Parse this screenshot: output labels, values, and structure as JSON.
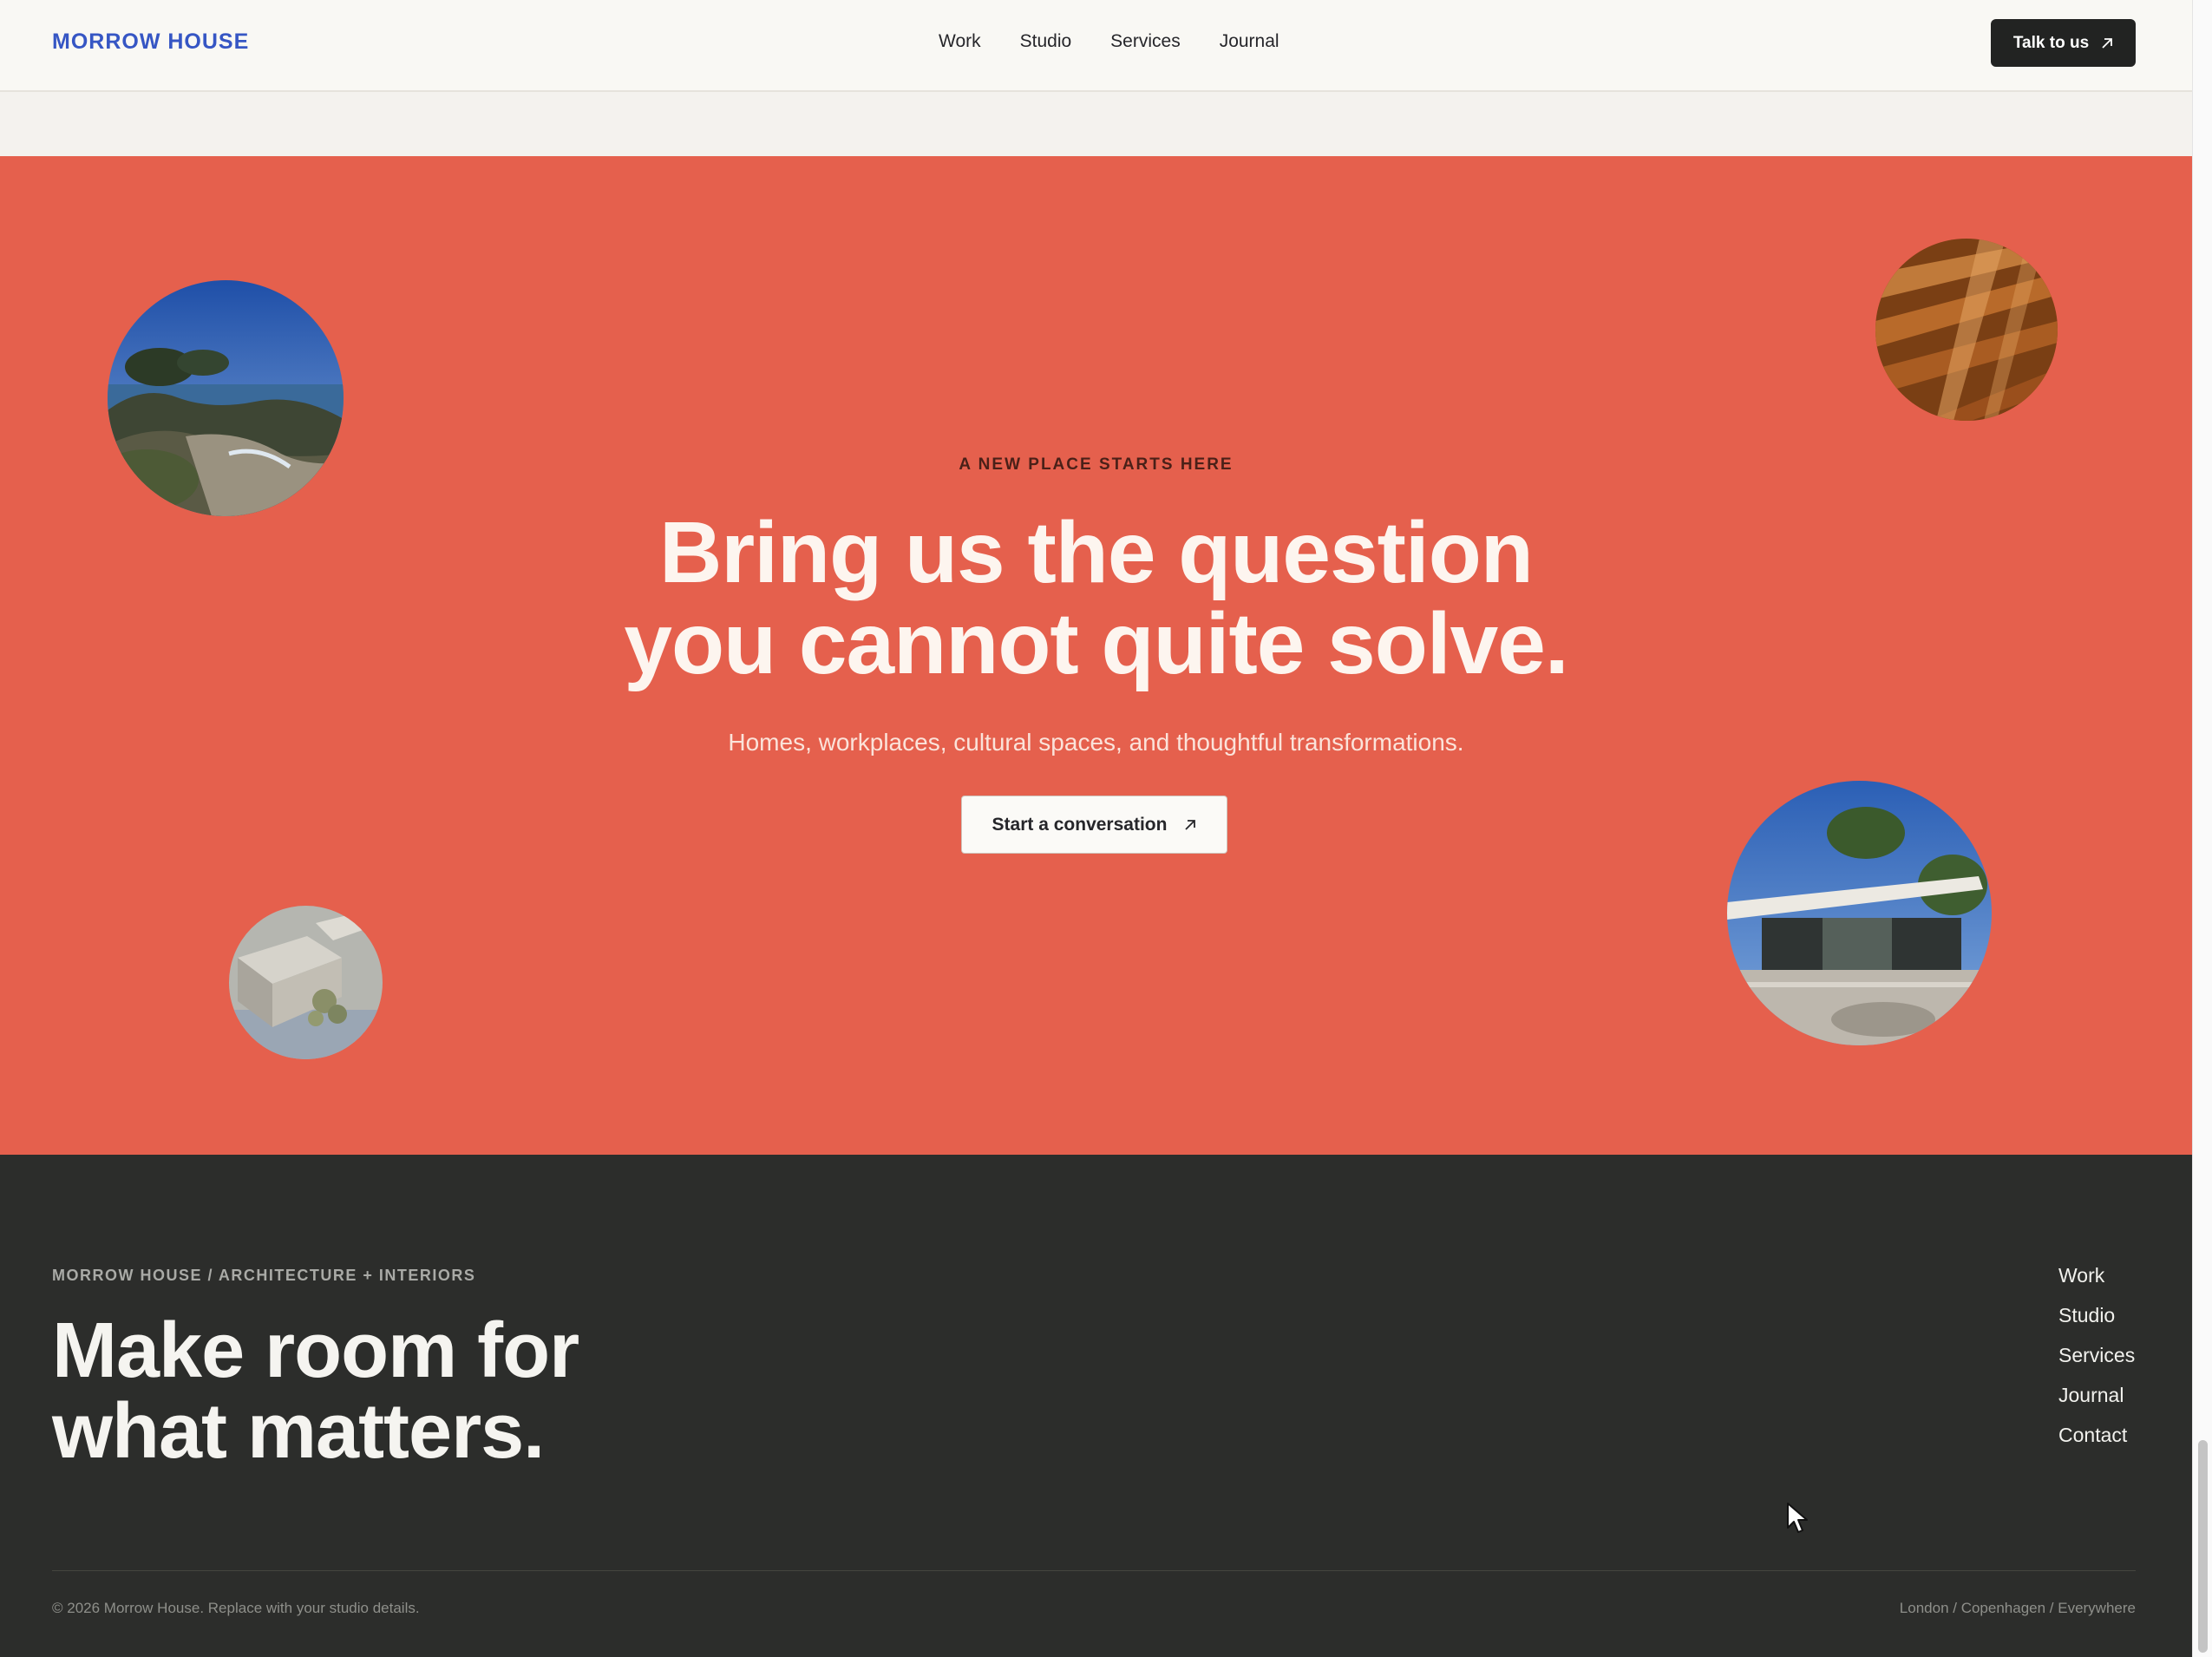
{
  "header": {
    "logo": "MORROW HOUSE",
    "nav": [
      "Work",
      "Studio",
      "Services",
      "Journal"
    ],
    "cta_label": "Talk to us"
  },
  "hero": {
    "eyebrow": "A NEW PLACE STARTS HERE",
    "headline_line1": "Bring us the question",
    "headline_line2": "you cannot quite solve.",
    "subline": "Homes, workplaces, cultural spaces, and thoughtful transformations.",
    "cta_label": "Start a conversation",
    "images": [
      "coastline-photo",
      "timber-facade-photo",
      "architectural-model-photo",
      "pavilion-photo"
    ],
    "background_color": "#e5604d"
  },
  "footer": {
    "eyebrow": "MORROW HOUSE / ARCHITECTURE + INTERIORS",
    "title_line1": "Make room for",
    "title_line2": "what matters.",
    "nav": [
      "Work",
      "Studio",
      "Services",
      "Journal",
      "Contact"
    ],
    "copyright": "© 2026 Morrow House. Replace with your studio details.",
    "locations": "London / Copenhagen / Everywhere",
    "background_color": "#2c2d2b"
  },
  "colors": {
    "brand_blue": "#3656c4",
    "dark_button": "#222322",
    "page_light": "#f9f8f4"
  }
}
